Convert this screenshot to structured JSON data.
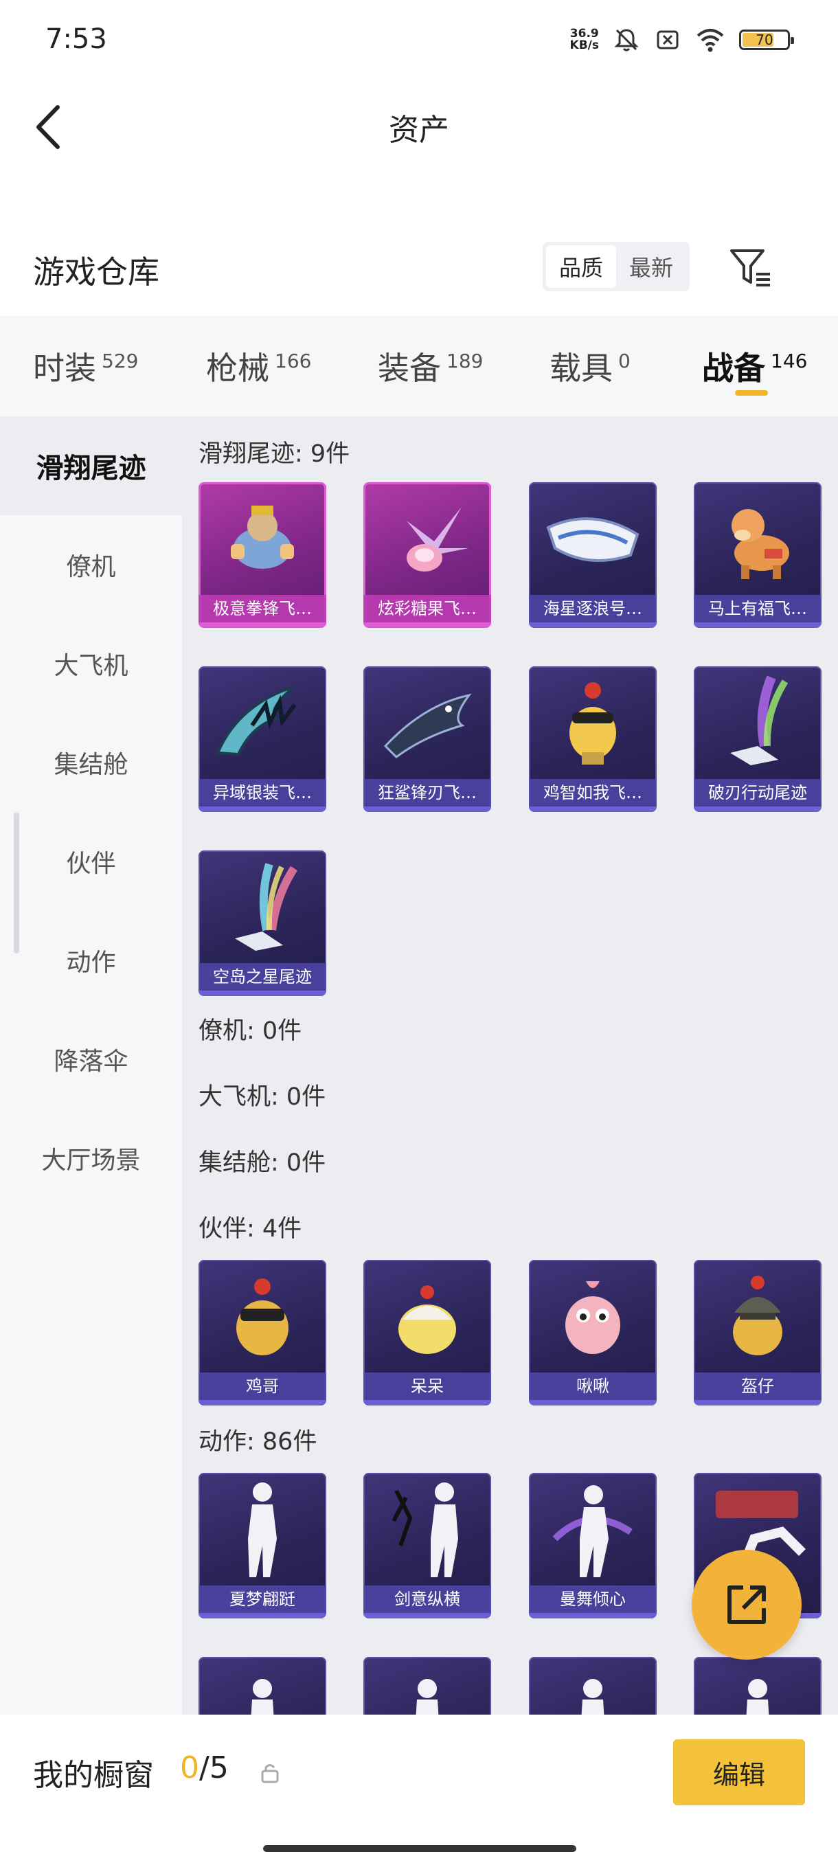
{
  "status": {
    "time": "7:53",
    "speed_value": "36.9",
    "speed_unit": "KB/s",
    "battery": "70"
  },
  "header": {
    "title": "资产"
  },
  "warehouse": {
    "title": "游戏仓库",
    "sort_options": [
      "品质",
      "最新"
    ]
  },
  "tabs": [
    {
      "label": "时装",
      "count": "529"
    },
    {
      "label": "枪械",
      "count": "166"
    },
    {
      "label": "装备",
      "count": "189"
    },
    {
      "label": "载具",
      "count": "0"
    },
    {
      "label": "战备",
      "count": "146"
    }
  ],
  "sidebar": {
    "items": [
      "滑翔尾迹",
      "僚机",
      "大飞机",
      "集结舱",
      "伙伴",
      "动作",
      "降落伞",
      "大厅场景"
    ]
  },
  "sections": {
    "glide": {
      "title": "滑翔尾迹: 9件",
      "items": [
        "极意拳锋飞…",
        "炫彩糖果飞…",
        "海星逐浪号…",
        "马上有福飞…",
        "异域银装飞…",
        "狂鲨锋刃飞…",
        "鸡智如我飞…",
        "破刃行动尾迹",
        "空岛之星尾迹"
      ]
    },
    "wingman": {
      "title": "僚机: 0件"
    },
    "plane": {
      "title": "大飞机: 0件"
    },
    "pod": {
      "title": "集结舱: 0件"
    },
    "partner": {
      "title": "伙伴: 4件",
      "items": [
        "鸡哥",
        "呆呆",
        "啾啾",
        "盔仔"
      ]
    },
    "emote": {
      "title": "动作: 86件",
      "items": [
        "夏梦翩跹",
        "剑意纵横",
        "曼舞倾心"
      ]
    }
  },
  "bottom": {
    "window_label": "我的橱窗",
    "window_current": "0",
    "window_total": "/5",
    "edit_label": "编辑"
  },
  "colors": {
    "accent": "#f0b429",
    "card_bg": "#2b2458",
    "card_pink": "#b23ba8"
  }
}
